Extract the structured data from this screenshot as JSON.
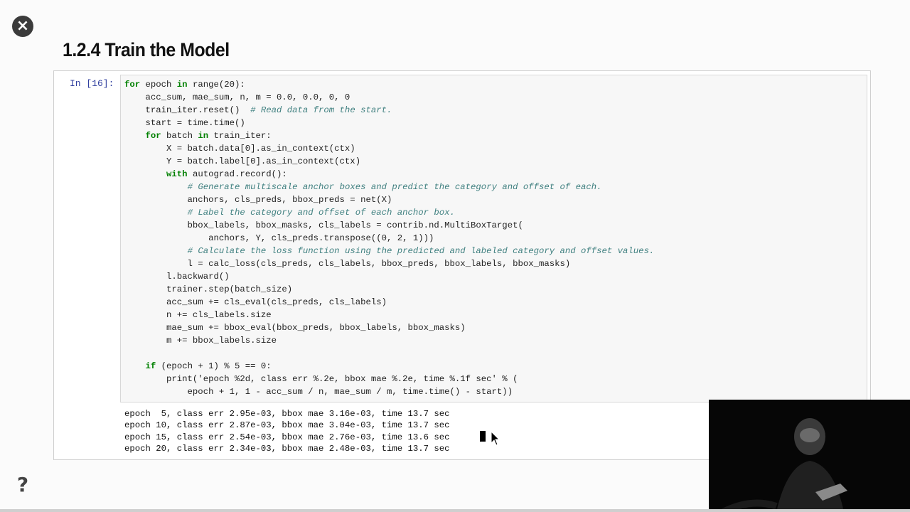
{
  "toolbar": {
    "close_icon": "×",
    "help_icon": "?"
  },
  "section": {
    "heading": "1.2.4  Train the Model"
  },
  "cell": {
    "prompt": "In [16]:",
    "code": "for epoch in range(20):\n    acc_sum, mae_sum, n, m = 0.0, 0.0, 0, 0\n    train_iter.reset()  # Read data from the start.\n    start = time.time()\n    for batch in train_iter:\n        X = batch.data[0].as_in_context(ctx)\n        Y = batch.label[0].as_in_context(ctx)\n        with autograd.record():\n            # Generate multiscale anchor boxes and predict the category and offset of each.\n            anchors, cls_preds, bbox_preds = net(X)\n            # Label the category and offset of each anchor box.\n            bbox_labels, bbox_masks, cls_labels = contrib.nd.MultiBoxTarget(\n                anchors, Y, cls_preds.transpose((0, 2, 1)))\n            # Calculate the loss function using the predicted and labeled category and offset values.\n            l = calc_loss(cls_preds, cls_labels, bbox_preds, bbox_labels, bbox_masks)\n        l.backward()\n        trainer.step(batch_size)\n        acc_sum += cls_eval(cls_preds, cls_labels)\n        n += cls_labels.size\n        mae_sum += bbox_eval(bbox_preds, bbox_labels, bbox_masks)\n        m += bbox_labels.size\n\n    if (epoch + 1) % 5 == 0:\n        print('epoch %2d, class err %.2e, bbox mae %.2e, time %.1f sec' % (\n            epoch + 1, 1 - acc_sum / n, mae_sum / m, time.time() - start))",
    "output": "epoch  5, class err 2.95e-03, bbox mae 3.16e-03, time 13.7 sec\nepoch 10, class err 2.87e-03, bbox mae 3.04e-03, time 13.7 sec\nepoch 15, class err 2.54e-03, bbox mae 2.76e-03, time 13.6 sec\nepoch 20, class err 2.34e-03, bbox mae 2.48e-03, time 13.7 sec"
  },
  "colors": {
    "keyword": "#008000",
    "comment": "#408080",
    "prompt": "#303f9f"
  }
}
